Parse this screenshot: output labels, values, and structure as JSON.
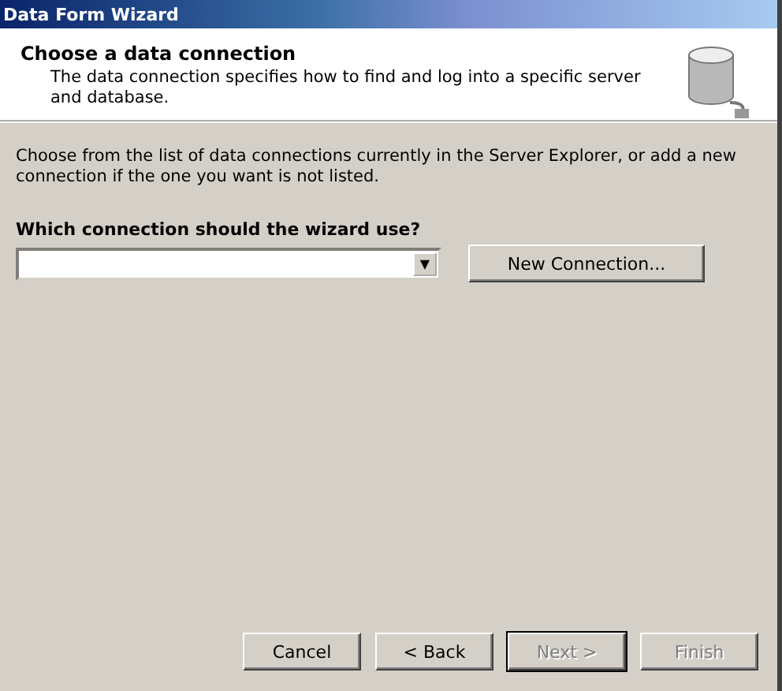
{
  "window": {
    "title": "Data Form Wizard"
  },
  "header": {
    "title": "Choose a data connection",
    "description": "The data connection specifies how to find and log into a specific server and database."
  },
  "instructions": "Choose from the list of data connections currently in the Server Explorer, or add a new connection if the one you want is not listed.",
  "connection_label": "Which connection should the wizard use?",
  "connection_dropdown": {
    "arrow": "▼"
  },
  "new_connection_button": {
    "label": "New Connection...",
    "disabled": false,
    "default": false
  },
  "buttons": [
    {
      "label": "Cancel",
      "disabled": false,
      "default": false
    },
    {
      "label": "< Back",
      "disabled": false,
      "default": false
    },
    {
      "label": "Next >",
      "disabled": true,
      "default": true
    },
    {
      "label": "Finish",
      "disabled": true,
      "default": false
    }
  ]
}
